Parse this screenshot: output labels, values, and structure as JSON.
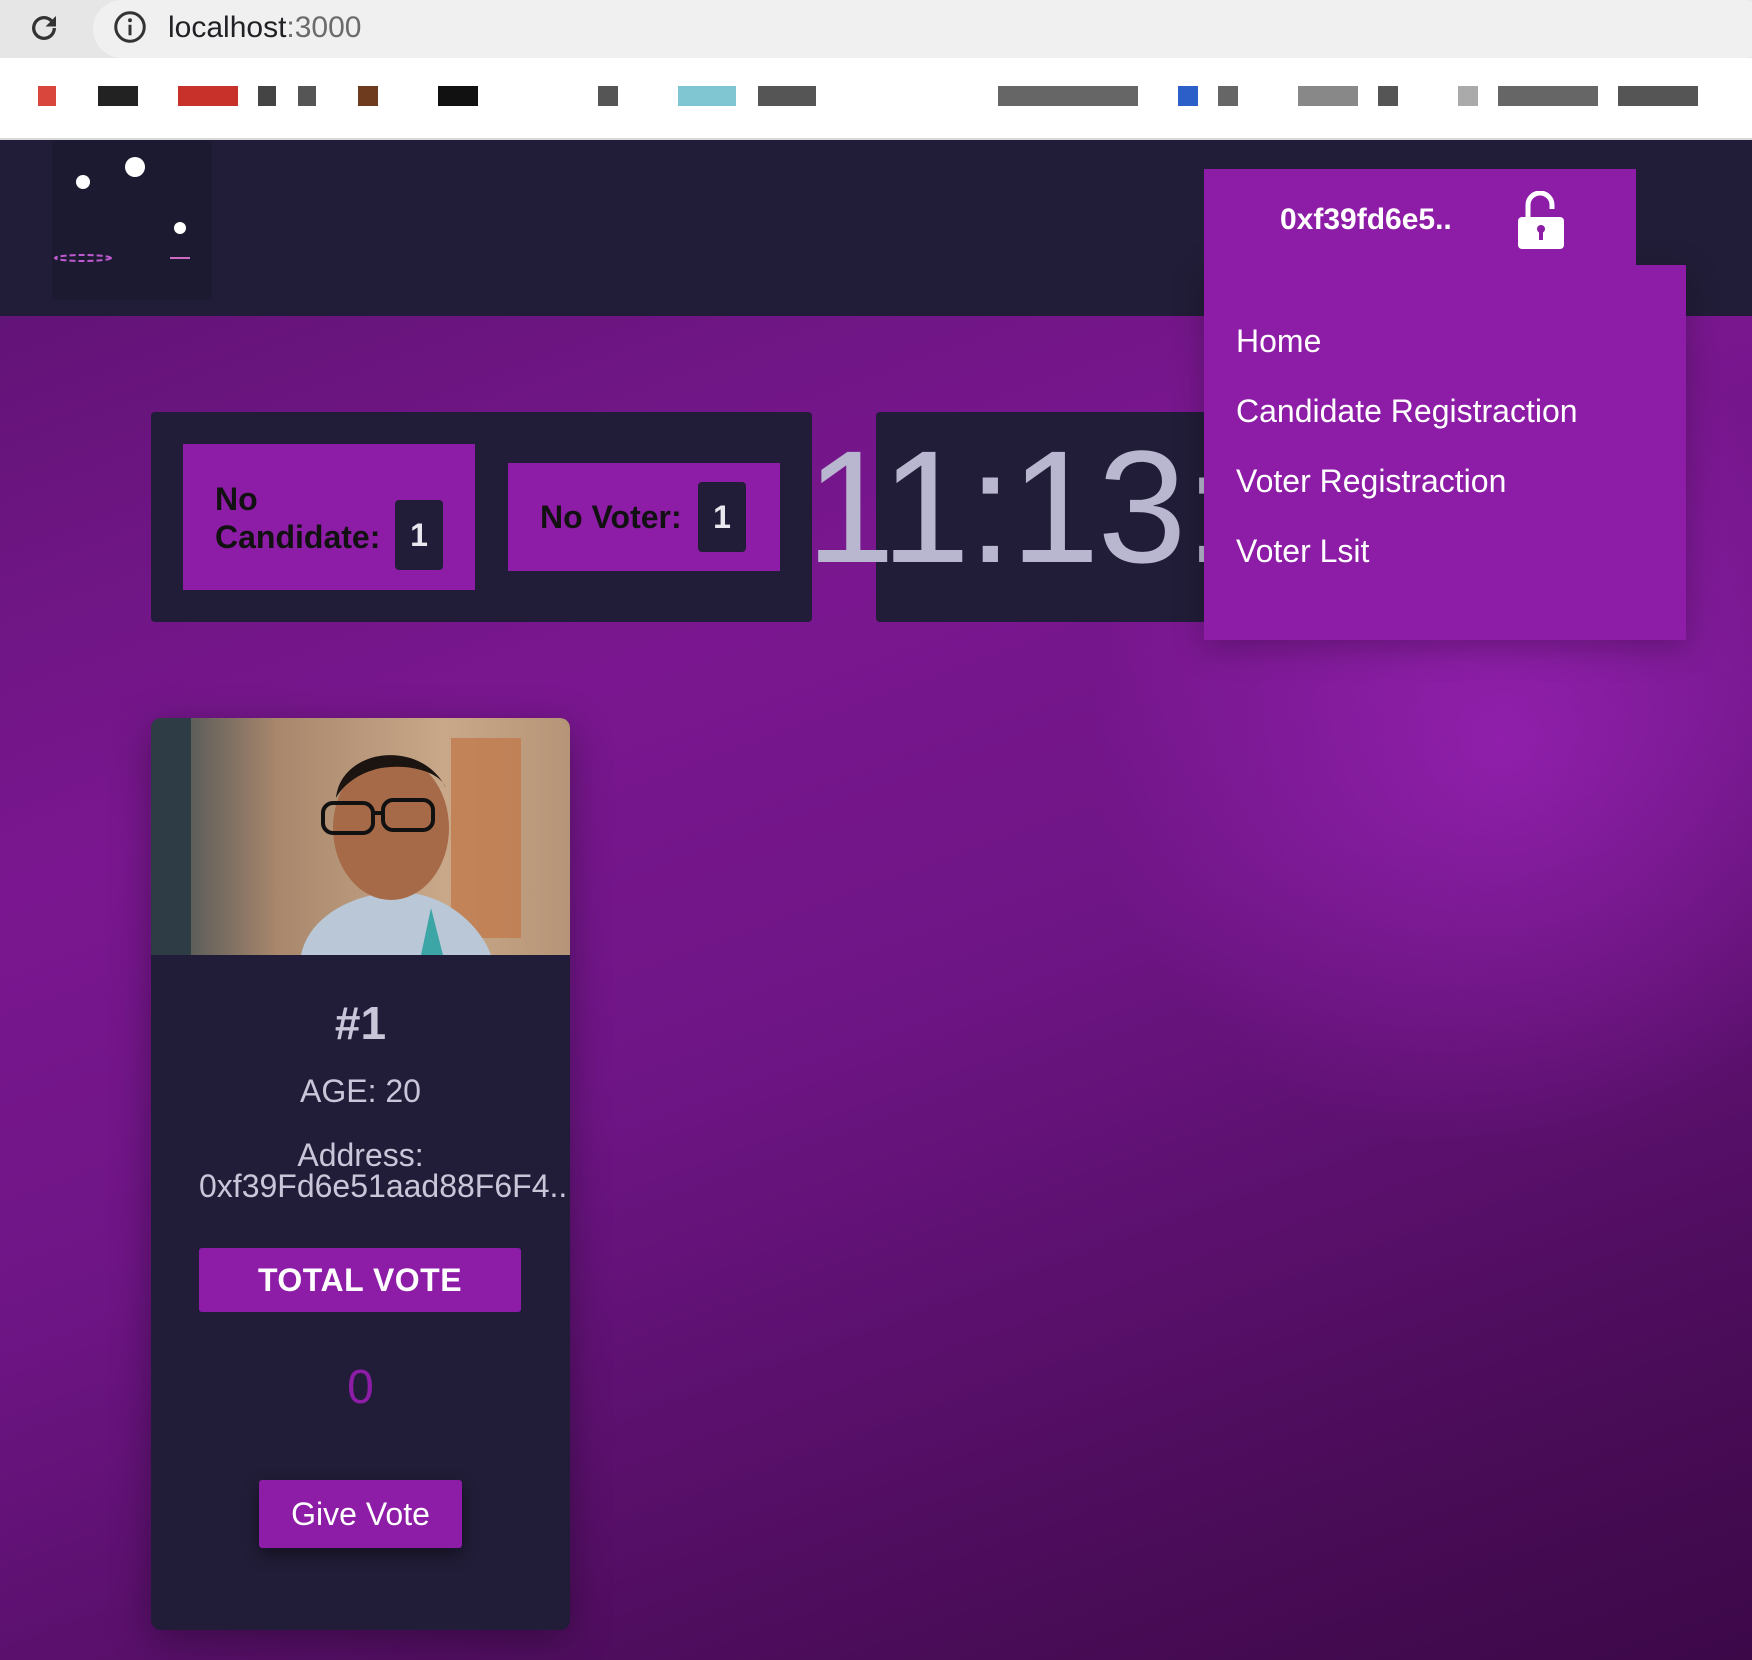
{
  "browser": {
    "url_host": "localhost",
    "url_port": ":3000"
  },
  "header": {
    "wallet_address": "0xf39fd6e5..",
    "menu": [
      {
        "label": "Home"
      },
      {
        "label": "Candidate Registraction"
      },
      {
        "label": "Voter Registraction"
      },
      {
        "label": "Voter Lsit"
      }
    ]
  },
  "stats": {
    "candidate_label": "No Candidate:",
    "candidate_label_line1": "No",
    "candidate_label_line2": "Candidate:",
    "candidate_count": "1",
    "voter_label": "No Voter:",
    "voter_count": "1"
  },
  "clock": {
    "visible_time": "11:13:4"
  },
  "candidate_card": {
    "number": "#1",
    "age": "AGE: 20",
    "address_label": "Address:",
    "address": "0xf39Fd6e51aad88F6F4..",
    "total_vote_label": "TOTAL VOTE",
    "vote_count": "0",
    "give_vote_label": "Give Vote"
  },
  "colors": {
    "accent": "#8d1ca6",
    "navbar": "#211d38",
    "page_gradient_start": "#5c1370",
    "page_gradient_end": "#3c0848"
  }
}
